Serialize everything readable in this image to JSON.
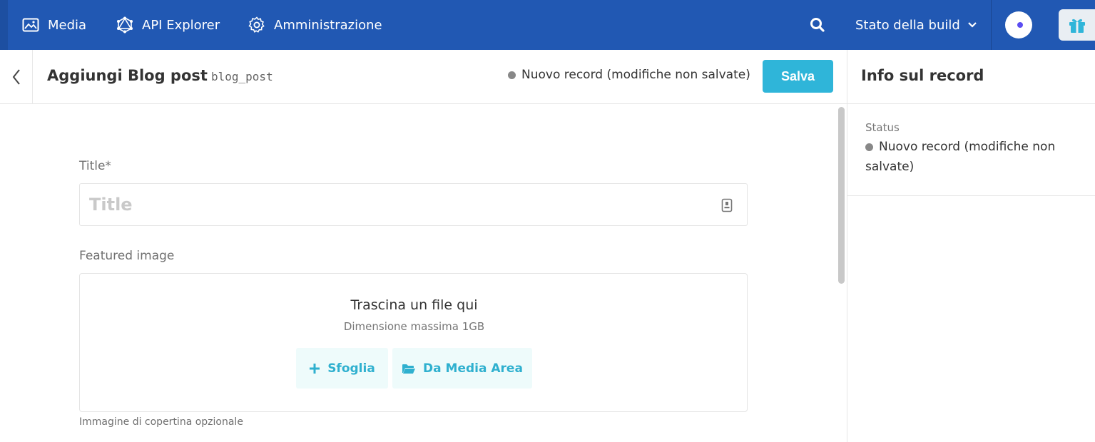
{
  "topbar": {
    "nav": [
      {
        "label": "Media",
        "icon": "image-icon"
      },
      {
        "label": "API Explorer",
        "icon": "graphql-icon"
      },
      {
        "label": "Amministrazione",
        "icon": "gear-icon"
      }
    ],
    "build_status_label": "Stato della build",
    "colors": {
      "background": "#2158b3",
      "accent": "#2fb5d9"
    }
  },
  "header": {
    "title": "Aggiungi Blog post",
    "api_key": "blog_post",
    "record_status": "Nuovo record (modifiche non salvate)",
    "save_label": "Salva"
  },
  "form": {
    "title_field": {
      "label": "Title*",
      "placeholder": "Title",
      "value": ""
    },
    "image_field": {
      "label": "Featured image",
      "drop_text": "Trascina un file qui",
      "max_size": "Dimensione massima 1GB",
      "browse_label": "Sfoglia",
      "media_area_label": "Da Media Area",
      "hint": "Immagine di copertina opzionale"
    }
  },
  "sidebar": {
    "title": "Info sul record",
    "status_label": "Status",
    "status_value": "Nuovo record (modifiche non salvate)"
  }
}
